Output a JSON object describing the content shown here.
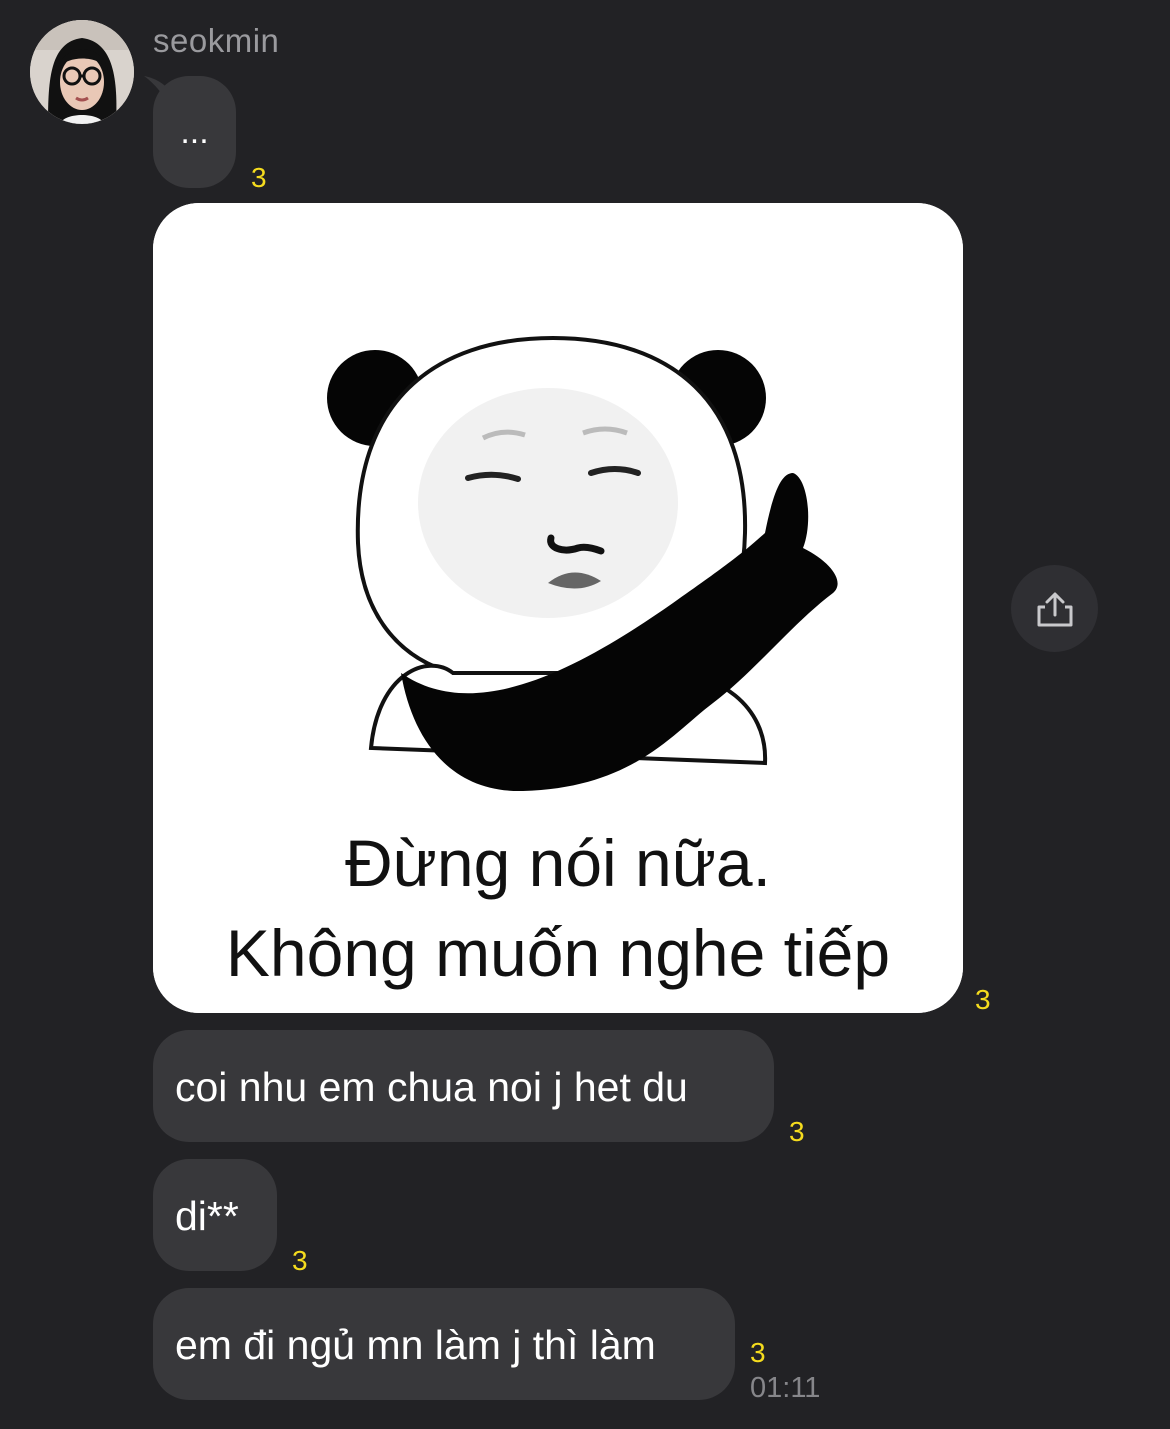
{
  "sender": {
    "name": "seokmin"
  },
  "messages": [
    {
      "type": "text",
      "text": "...",
      "unread": "3"
    },
    {
      "type": "sticker",
      "caption_line1": "Đừng nói nữa.",
      "caption_line2": "Không muốn nghe tiếp",
      "unread": "3"
    },
    {
      "type": "text",
      "text": "coi nhu em chua noi j het du",
      "unread": "3"
    },
    {
      "type": "text",
      "text": "di**",
      "unread": "3"
    },
    {
      "type": "text",
      "text": "em đi ngủ mn làm j thì làm",
      "unread": "3",
      "time": "01:11"
    }
  ],
  "icons": {
    "share": "share-icon"
  },
  "colors": {
    "background": "#222225",
    "bubble": "#38383b",
    "unread": "#f5dc1e",
    "text": "#ffffff",
    "meta": "#86868a"
  }
}
